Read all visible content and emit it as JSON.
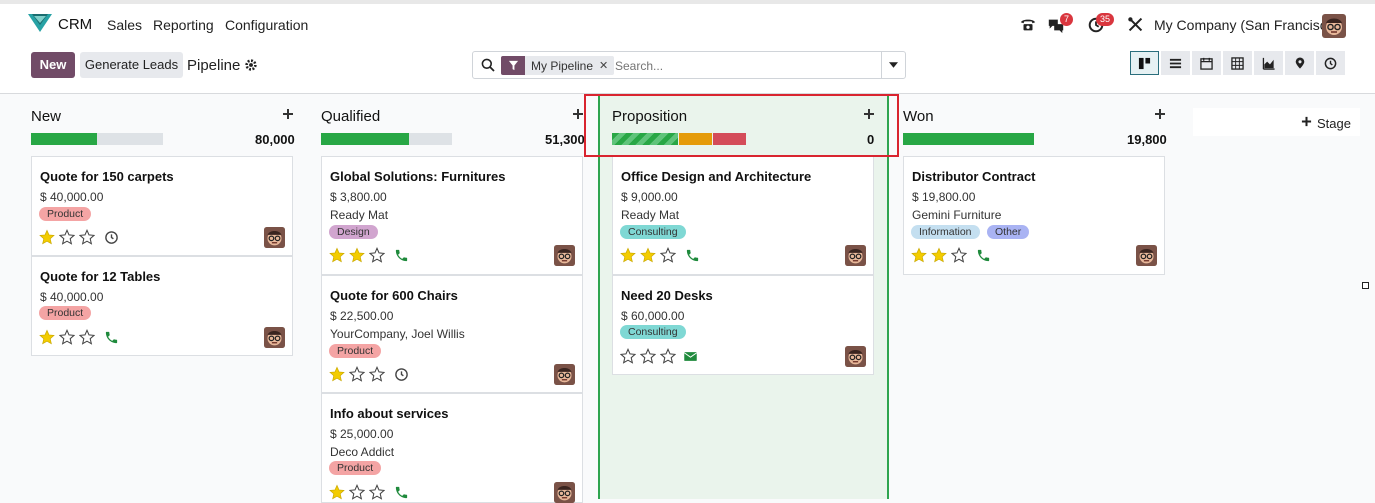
{
  "app": {
    "name": "CRM",
    "menu": [
      "Sales",
      "Reporting",
      "Configuration"
    ]
  },
  "systray": {
    "messages_count": "7",
    "activities_count": "35",
    "company": "My Company (San Francisco)"
  },
  "control": {
    "new_label": "New",
    "generate_label": "Generate Leads",
    "breadcrumb": "Pipeline"
  },
  "search": {
    "facet": "My Pipeline",
    "placeholder": "Search..."
  },
  "colors": {
    "brand": "#714b67",
    "won": "#28a745",
    "warn": "#e59b0a",
    "danger": "#d44c59",
    "empty": "#dee2e6",
    "highlight": "#d9242f"
  },
  "stages": [
    {
      "name": "New",
      "total": "80,000"
    },
    {
      "name": "Qualified",
      "total": "51,300"
    },
    {
      "name": "Proposition",
      "total": "0"
    },
    {
      "name": "Won",
      "total": "19,800"
    }
  ],
  "cards": {
    "new": [
      {
        "title": "Quote for 150 carpets",
        "amount": "$ 40,000.00",
        "tag": "Product",
        "stars": 1,
        "activity": "clock-icon"
      },
      {
        "title": "Quote for 12 Tables",
        "amount": "$ 40,000.00",
        "tag": "Product",
        "stars": 1,
        "activity": "phone-icon"
      }
    ],
    "qualified": [
      {
        "title": "Global Solutions: Furnitures",
        "amount": "$ 3,800.00",
        "customer": "Ready Mat",
        "tag": "Design",
        "stars": 2,
        "activity": "phone-icon"
      },
      {
        "title": "Quote for 600 Chairs",
        "amount": "$ 22,500.00",
        "customer": "YourCompany, Joel Willis",
        "tag": "Product",
        "stars": 1,
        "activity": "clock-icon"
      },
      {
        "title": "Info about services",
        "amount": "$ 25,000.00",
        "customer": "Deco Addict",
        "tag": "Product",
        "stars": 1,
        "activity": "phone-icon"
      }
    ],
    "proposition": [
      {
        "title": "Office Design and Architecture",
        "amount": "$ 9,000.00",
        "customer": "Ready Mat",
        "tag": "Consulting",
        "stars": 2,
        "activity": "phone-icon"
      },
      {
        "title": "Need 20 Desks",
        "amount": "$ 60,000.00",
        "tag": "Consulting",
        "stars": 0,
        "activity": "envelope-icon"
      }
    ],
    "won": [
      {
        "title": "Distributor Contract",
        "amount": "$ 19,800.00",
        "customer": "Gemini Furniture",
        "tags": [
          "Information",
          "Other"
        ],
        "stars": 2,
        "activity": "phone-icon"
      }
    ]
  },
  "add_stage_label": "Stage",
  "progress": {
    "new": {
      "planned": 0.5,
      "empty": 0.5
    },
    "qualified": {
      "planned": 0.67,
      "empty": 0.33
    },
    "proposition": {
      "planned": 0.5,
      "warning": 0.25,
      "overdue": 0.25
    },
    "won": {
      "won": 1.0
    }
  }
}
